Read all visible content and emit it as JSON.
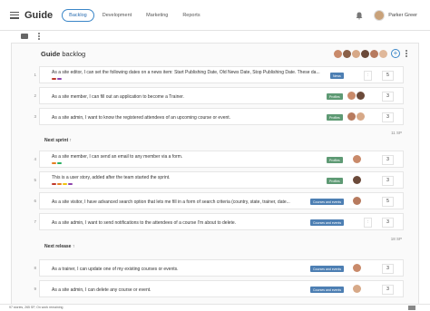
{
  "app": {
    "title": "Guide",
    "user_name": "Parker Greer"
  },
  "tabs": [
    {
      "label": "Backlog",
      "active": true
    },
    {
      "label": "Development",
      "active": false
    },
    {
      "label": "Marketing",
      "active": false
    },
    {
      "label": "Reports",
      "active": false
    }
  ],
  "backlog": {
    "title_strong": "Guide",
    "title_rest": " backlog"
  },
  "stories": [
    {
      "num": "1",
      "text": "As a site editor, I can set the following dates on a news item: Start Publishing Date, Old News Date, Stop Publishing Date. These da...",
      "tag": "News",
      "points": "5"
    },
    {
      "num": "2",
      "text": "As a site member, I can fill out an application to become a Trainer.",
      "tag": "Profiles",
      "points": "3"
    },
    {
      "num": "3",
      "text": "As a site admin, I want to know the registered attendees of an upcoming course or event.",
      "tag": "Profiles",
      "points": "3"
    },
    {
      "num": "4",
      "text": "As a site member, I can send an email to any member via a form.",
      "tag": "Profiles",
      "points": "3"
    },
    {
      "num": "5",
      "text": "This is a user story, added after the team started the sprint.",
      "tag": "Profiles",
      "points": "3"
    },
    {
      "num": "6",
      "text": "As a site visitor, I have advanced search option that lets me fill in a form of search criteria (country, state, trainer, date...",
      "tag": "Courses and events",
      "points": "5"
    },
    {
      "num": "7",
      "text": "As a site admin, I want to send notifications to the attendees of a course I'm about to delete.",
      "tag": "Courses and events",
      "points": "3"
    },
    {
      "num": "8",
      "text": "As a trainer, I can update one of my existing courses or events.",
      "tag": "Courses and events",
      "points": "3"
    },
    {
      "num": "9",
      "text": "As a site admin, I can delete any course or event.",
      "tag": "Courses and events",
      "points": "3"
    }
  ],
  "sections": {
    "backlog_sp": "11 SP",
    "sprint_label": "Next sprint",
    "sprint_sp": "18 SP",
    "release_label": "Next release"
  },
  "status_text": "97 stories, 265 SP, On work remaining",
  "colors": {
    "accent": "#3a86c8",
    "profiles": "#5e9a74",
    "courses": "#4d7fb3"
  }
}
